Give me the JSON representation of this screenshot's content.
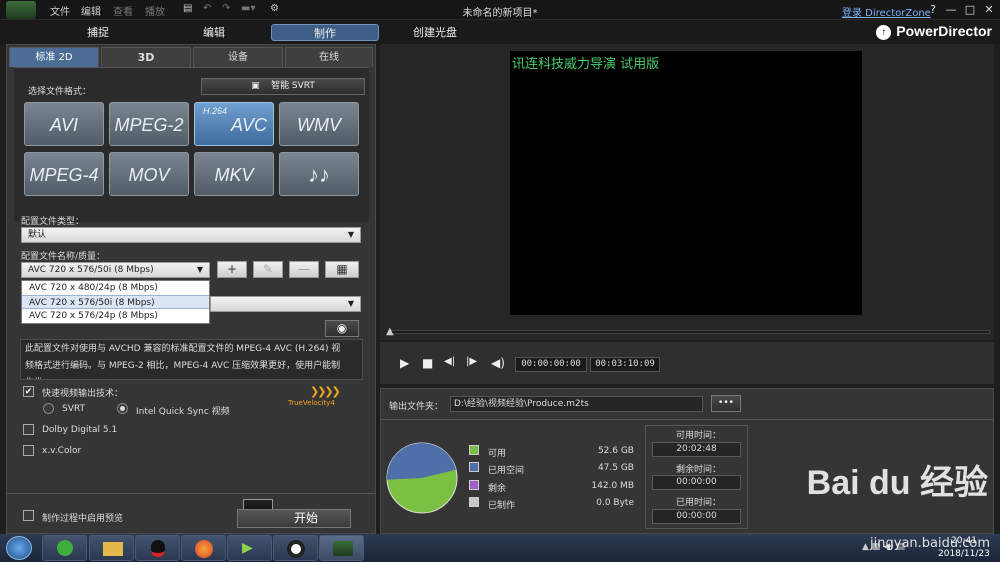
{
  "menu": {
    "file": "文件",
    "edit": "编辑",
    "view": "查看",
    "play": "播放"
  },
  "window": {
    "title": "未命名的新项目*",
    "login": "登录 DirectorZone",
    "help": "?",
    "minimize": "—",
    "maximize": "□",
    "close": "✕"
  },
  "modes": {
    "capture": "捕捉",
    "edit": "编辑",
    "produce": "制作",
    "disc": "创建光盘"
  },
  "brand": "PowerDirector",
  "subtabs": {
    "standard": "标准 2D",
    "threeD": "3D",
    "device": "设备",
    "online": "在线"
  },
  "format": {
    "label": "选择文件格式：",
    "svrt": "智能 SVRT",
    "buttons": [
      "AVI",
      "MPEG-2",
      "AVC",
      "WMV",
      "MPEG-4",
      "MOV",
      "MKV",
      "♪♪"
    ],
    "avc_prefix": "H.264"
  },
  "profile_type": {
    "label": "配置文件类型：",
    "value": "默认"
  },
  "profile_name": {
    "label": "配置文件名称/质量：",
    "value": "AVC 720 x 576/50i (8 Mbps)",
    "add": "+",
    "delete": "—"
  },
  "profile_options": [
    "AVC 720 x 480/24p (8 Mbps)",
    "AVC 720 x 576/50i (8 Mbps)",
    "AVC 720 x 576/24p (8 Mbps)"
  ],
  "description": "此配置文件对使用与 AVCHD 兼容的标准配置文件的 MPEG-4 AVC (H.264) 视频格式进行编码。与 MPEG-2 相比，MPEG-4 AVC 压缩效果更好，使用户能制作类",
  "options": {
    "fast_render": "快速视频输出技术：",
    "svrt": "SVRT",
    "quicksync": "Intel Quick Sync 视频",
    "truevelocity": "TrueVelocity4",
    "dolby": "Dolby Digital 5.1",
    "xvcolor": "x.v.Color",
    "preview": "制作过程中启用预览"
  },
  "start": "开始",
  "preview": {
    "watermark": "讯连科技威力导演 试用版",
    "timecode": "00:00:00:00",
    "duration": "00:03:10:09"
  },
  "output": {
    "label": "输出文件夹：",
    "path": "D:\\经验\\视频经验\\Produce.m2ts",
    "browse": "•••"
  },
  "disk": {
    "available_label": "可用",
    "available": "52.6  GB",
    "used_label": "已用空间",
    "used": "47.5  GB",
    "remaining_label": "剩余",
    "remaining": "142.0  MB",
    "produced_label": "已制作",
    "produced": "0.0  Byte",
    "used_fraction": 0.47,
    "colors": {
      "available": "#7bc043",
      "used": "#4e6fa8",
      "remaining": "#a35fc7",
      "produced": "#c8c8c8"
    }
  },
  "times": {
    "available_label": "可用时间：",
    "available": "20:02:48",
    "remaining_label": "剩余时间：",
    "remaining": "00:00:00",
    "elapsed_label": "已用时间：",
    "elapsed": "00:00:00"
  },
  "taskbar": {
    "time": "20:41",
    "date": "2018/11/23"
  },
  "watermark_brand": {
    "text": "Bai du 经验",
    "url": "jingyan.baidu.com"
  }
}
